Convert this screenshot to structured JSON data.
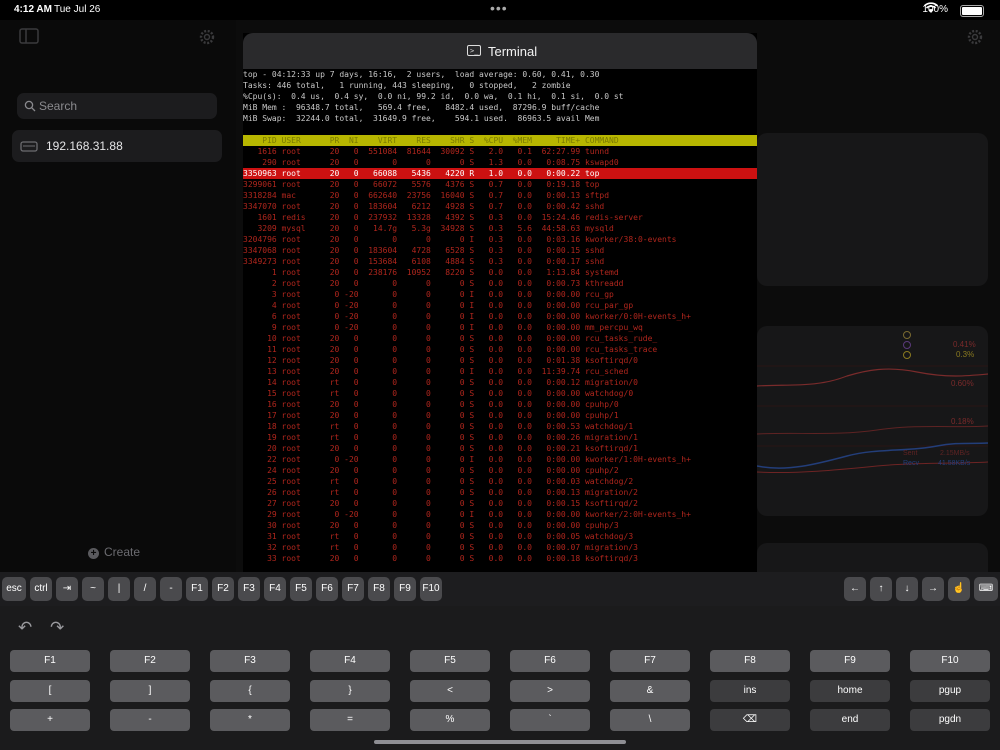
{
  "status_bar": {
    "time": "4:12 AM",
    "date": "Tue Jul 26",
    "battery": "100%",
    "dots": "•••"
  },
  "sidebar": {
    "search_placeholder": "Search",
    "server_item": "192.168.31.88",
    "create_label": "Create"
  },
  "terminal": {
    "title": "Terminal",
    "header_lines": [
      "top - 04:12:33 up 7 days, 16:16,  2 users,  load average: 0.60, 0.41, 0.30",
      "Tasks: 446 total,   1 running, 443 sleeping,   0 stopped,   2 zombie",
      "%Cpu(s):  0.4 us,  0.4 sy,  0.0 ni, 99.2 id,  0.0 wa,  0.1 hi,  0.1 si,  0.0 st",
      "MiB Mem :  96348.7 total,   569.4 free,   8482.4 used,  87296.9 buff/cache",
      "MiB Swap:  32244.0 total,  31649.9 free,    594.1 used.  86963.5 avail Mem"
    ],
    "column_header": "    PID USER      PR  NI    VIRT    RES    SHR S  %CPU  %MEM     TIME+ COMMAND",
    "highlight_row": "3350963 root      20   0   66088   5436   4220 R   1.0   0.0   0:00.22 top",
    "processes": [
      "   1616 root      20   0  551084  81644  30092 S   2.0   0.1  62:27.99 tunnd",
      "    290 root      20   0       0      0      0 S   1.3   0.0   0:08.75 kswapd0",
      "3299061 root      20   0   66072   5576   4376 S   0.7   0.0   0:19.18 top",
      "3318284 mac       20   0  662640  23756  16040 S   0.7   0.0   0:00.13 sftpd",
      "3347070 root      20   0  183604   6212   4928 S   0.7   0.0   0:00.42 sshd",
      "   1601 redis     20   0  237932  13328   4392 S   0.3   0.0  15:24.46 redis-server",
      "   3209 mysql     20   0   14.7g   5.3g  34928 S   0.3   5.6  44:58.63 mysqld",
      "3204796 root      20   0       0      0      0 I   0.3   0.0   0:03.16 kworker/38:0-events",
      "3347068 root      20   0  183604   4728   6528 S   0.3   0.0   0:00.15 sshd",
      "3349273 root      20   0  153684   6108   4884 S   0.3   0.0   0:00.17 sshd",
      "      1 root      20   0  238176  10952   8220 S   0.0   0.0   1:13.84 systemd",
      "      2 root      20   0       0      0      0 S   0.0   0.0   0:00.73 kthreadd",
      "      3 root       0 -20       0      0      0 I   0.0   0.0   0:00.00 rcu_gp",
      "      4 root       0 -20       0      0      0 I   0.0   0.0   0:00.00 rcu_par_gp",
      "      6 root       0 -20       0      0      0 I   0.0   0.0   0:00.00 kworker/0:0H-events_h+",
      "      9 root       0 -20       0      0      0 I   0.0   0.0   0:00.00 mm_percpu_wq",
      "     10 root      20   0       0      0      0 S   0.0   0.0   0:00.00 rcu_tasks_rude_",
      "     11 root      20   0       0      0      0 S   0.0   0.0   0:00.00 rcu_tasks_trace",
      "     12 root      20   0       0      0      0 S   0.0   0.0   0:01.38 ksoftirqd/0",
      "     13 root      20   0       0      0      0 I   0.0   0.0  11:39.74 rcu_sched",
      "     14 root      rt   0       0      0      0 S   0.0   0.0   0:00.12 migration/0",
      "     15 root      rt   0       0      0      0 S   0.0   0.0   0:00.00 watchdog/0",
      "     16 root      20   0       0      0      0 S   0.0   0.0   0:00.00 cpuhp/0",
      "     17 root      20   0       0      0      0 S   0.0   0.0   0:00.00 cpuhp/1",
      "     18 root      rt   0       0      0      0 S   0.0   0.0   0:00.53 watchdog/1",
      "     19 root      rt   0       0      0      0 S   0.0   0.0   0:00.26 migration/1",
      "     20 root      20   0       0      0      0 S   0.0   0.0   0:00.21 ksoftirqd/1",
      "     22 root       0 -20       0      0      0 I   0.0   0.0   0:00.00 kworker/1:0H-events_h+",
      "     24 root      20   0       0      0      0 S   0.0   0.0   0:00.00 cpuhp/2",
      "     25 root      rt   0       0      0      0 S   0.0   0.0   0:00.03 watchdog/2",
      "     26 root      rt   0       0      0      0 S   0.0   0.0   0:00.13 migration/2",
      "     27 root      20   0       0      0      0 S   0.0   0.0   0:00.15 ksoftirqd/2",
      "     29 root       0 -20       0      0      0 I   0.0   0.0   0:00.00 kworker/2:0H-events_h+",
      "     30 root      20   0       0      0      0 S   0.0   0.0   0:00.00 cpuhp/3",
      "     31 root      rt   0       0      0      0 S   0.0   0.0   0:00.05 watchdog/3",
      "     32 root      rt   0       0      0      0 S   0.0   0.0   0:00.07 migration/3",
      "     33 root      20   0       0      0      0 S   0.0   0.0   0:00.18 ksoftirqd/3"
    ]
  },
  "background_stats": {
    "pcts": [
      "0.41%",
      "0.3%",
      "0.60%",
      "0.18%"
    ],
    "sent_label": "Sent",
    "sent_value": "2.15MB/s",
    "recv_label": "Recv",
    "recv_value": "41.58KB/s"
  },
  "accessory_keys": [
    "esc",
    "ctrl",
    "⇥",
    "~",
    "|",
    "/",
    "-",
    "F1",
    "F2",
    "F3",
    "F4",
    "F5",
    "F6",
    "F7",
    "F8",
    "F9",
    "F10"
  ],
  "arrow_keys": [
    "←",
    "↑",
    "↓",
    "→"
  ],
  "keyboard": {
    "row1": [
      "F1",
      "F2",
      "F3",
      "F4",
      "F5",
      "F6",
      "F7",
      "F8",
      "F9",
      "F10"
    ],
    "row2": [
      "[",
      "]",
      "{",
      "}",
      "<",
      ">",
      "&",
      "ins",
      "home",
      "pgup"
    ],
    "row3": [
      "+",
      "-",
      "*",
      "=",
      "%",
      "`",
      "\\",
      "⌫",
      "end",
      "pgdn"
    ]
  }
}
